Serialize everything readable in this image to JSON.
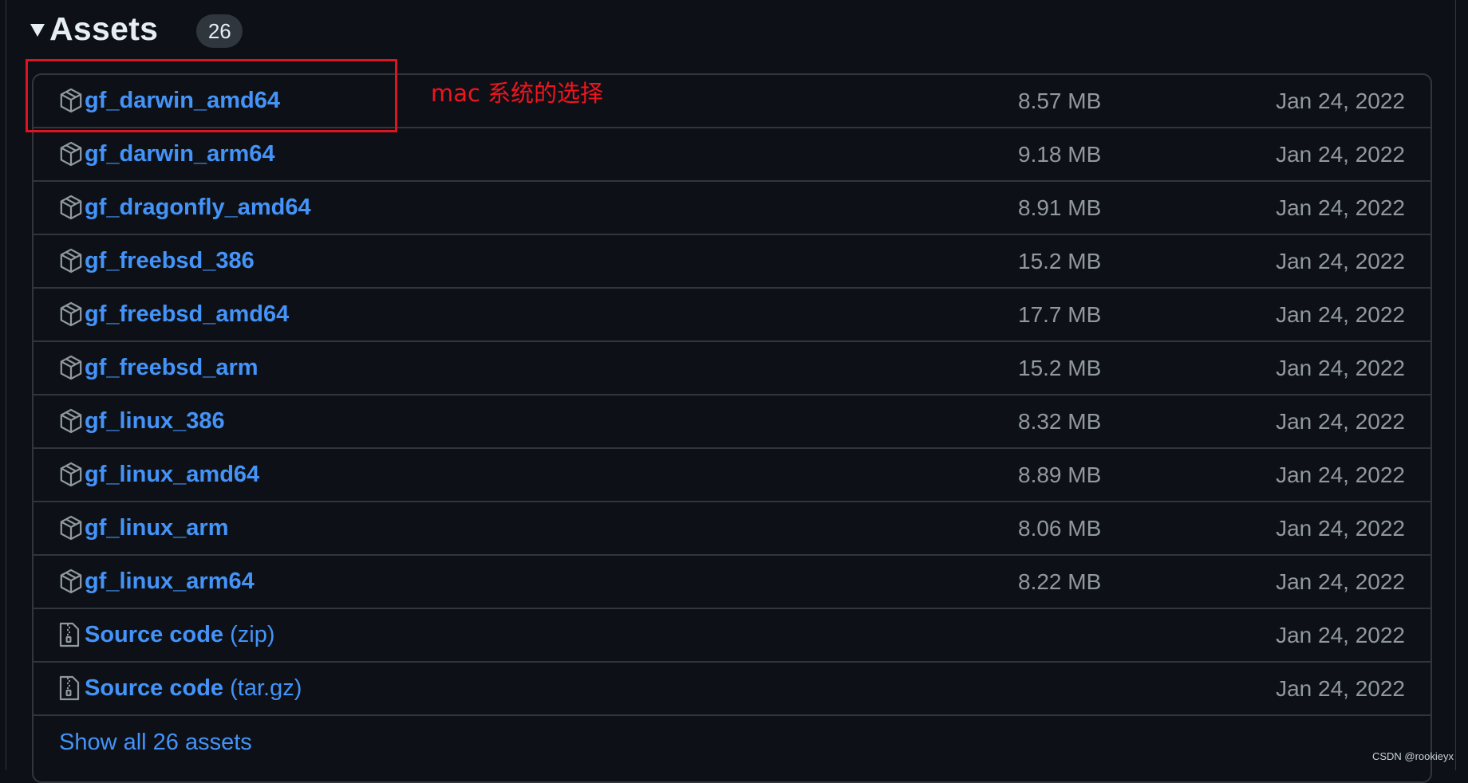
{
  "header": {
    "title": "Assets",
    "count": "26"
  },
  "assets": [
    {
      "name": "gf_darwin_amd64",
      "suffix": "",
      "size": "8.57 MB",
      "date": "Jan 24, 2022",
      "icon": "package-icon"
    },
    {
      "name": "gf_darwin_arm64",
      "suffix": "",
      "size": "9.18 MB",
      "date": "Jan 24, 2022",
      "icon": "package-icon"
    },
    {
      "name": "gf_dragonfly_amd64",
      "suffix": "",
      "size": "8.91 MB",
      "date": "Jan 24, 2022",
      "icon": "package-icon"
    },
    {
      "name": "gf_freebsd_386",
      "suffix": "",
      "size": "15.2 MB",
      "date": "Jan 24, 2022",
      "icon": "package-icon"
    },
    {
      "name": "gf_freebsd_amd64",
      "suffix": "",
      "size": "17.7 MB",
      "date": "Jan 24, 2022",
      "icon": "package-icon"
    },
    {
      "name": "gf_freebsd_arm",
      "suffix": "",
      "size": "15.2 MB",
      "date": "Jan 24, 2022",
      "icon": "package-icon"
    },
    {
      "name": "gf_linux_386",
      "suffix": "",
      "size": "8.32 MB",
      "date": "Jan 24, 2022",
      "icon": "package-icon"
    },
    {
      "name": "gf_linux_amd64",
      "suffix": "",
      "size": "8.89 MB",
      "date": "Jan 24, 2022",
      "icon": "package-icon"
    },
    {
      "name": "gf_linux_arm",
      "suffix": "",
      "size": "8.06 MB",
      "date": "Jan 24, 2022",
      "icon": "package-icon"
    },
    {
      "name": "gf_linux_arm64",
      "suffix": "",
      "size": "8.22 MB",
      "date": "Jan 24, 2022",
      "icon": "package-icon"
    },
    {
      "name": "Source code",
      "suffix": " (zip)",
      "size": "",
      "date": "Jan 24, 2022",
      "icon": "file-zip-icon"
    },
    {
      "name": "Source code",
      "suffix": " (tar.gz)",
      "size": "",
      "date": "Jan 24, 2022",
      "icon": "file-zip-icon"
    }
  ],
  "footer": {
    "show_all": "Show all 26 assets"
  },
  "annotation": {
    "text": "mac 系统的选择",
    "color": "#e0141e"
  },
  "watermark": "CSDN @rookieyx",
  "colors": {
    "background": "#0d1117",
    "link": "#4493f8",
    "muted": "#9198a1",
    "border": "#30363d"
  }
}
